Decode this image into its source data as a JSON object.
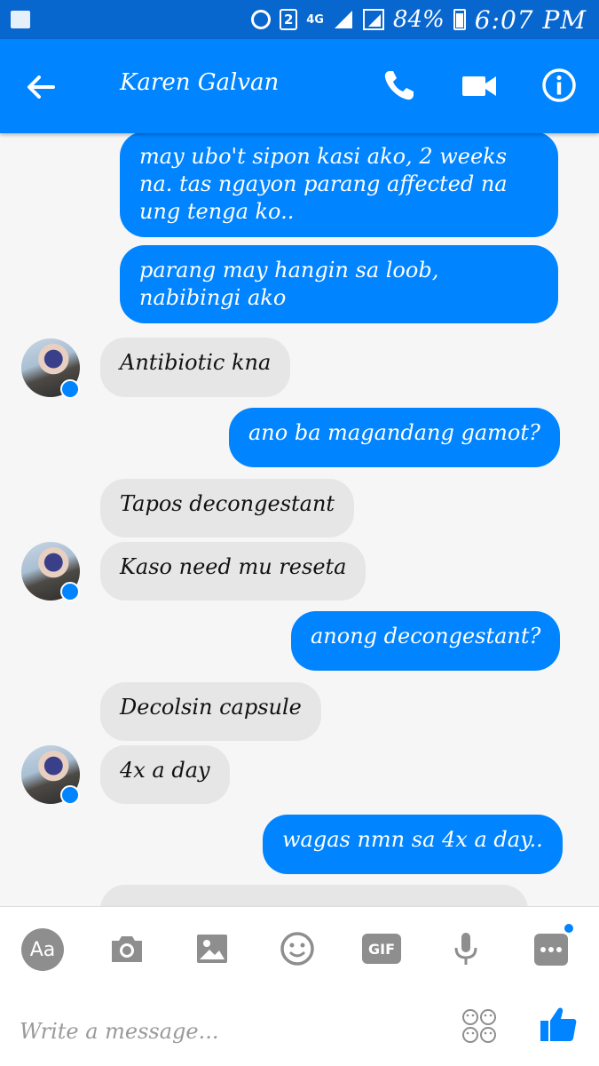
{
  "status_bar": {
    "battery": "84%",
    "time": "6:07 PM",
    "sim_slot": "2",
    "network": "4G"
  },
  "header": {
    "contact_name": "Karen Galvan"
  },
  "messages": [
    {
      "side": "out",
      "text": "may ubo't sipon kasi ako, 2 weeks na. tas ngayon parang affected na ung tenga ko.."
    },
    {
      "side": "out",
      "text": "parang may hangin sa loob, nabibingi ako"
    },
    {
      "side": "in",
      "text": "Antibiotic kna"
    },
    {
      "side": "out",
      "text": "ano ba magandang gamot?"
    },
    {
      "side": "in",
      "text": "Tapos decongestant"
    },
    {
      "side": "in",
      "text": "Kaso need mu reseta"
    },
    {
      "side": "out",
      "text": "anong decongestant?"
    },
    {
      "side": "in",
      "text": "Decolsin capsule"
    },
    {
      "side": "in",
      "text": "4x a day"
    },
    {
      "side": "out",
      "text": "wagas nmn sa 4x a day.."
    }
  ],
  "composer": {
    "aa_label": "Aa",
    "gif_label": "GIF",
    "placeholder": "Write a message..."
  },
  "colors": {
    "status_bar": "#0866cf",
    "header": "#0084ff",
    "outgoing_bubble": "#0084ff",
    "incoming_bubble": "#e6e6e6",
    "tool_icons": "#8e8e8e"
  }
}
